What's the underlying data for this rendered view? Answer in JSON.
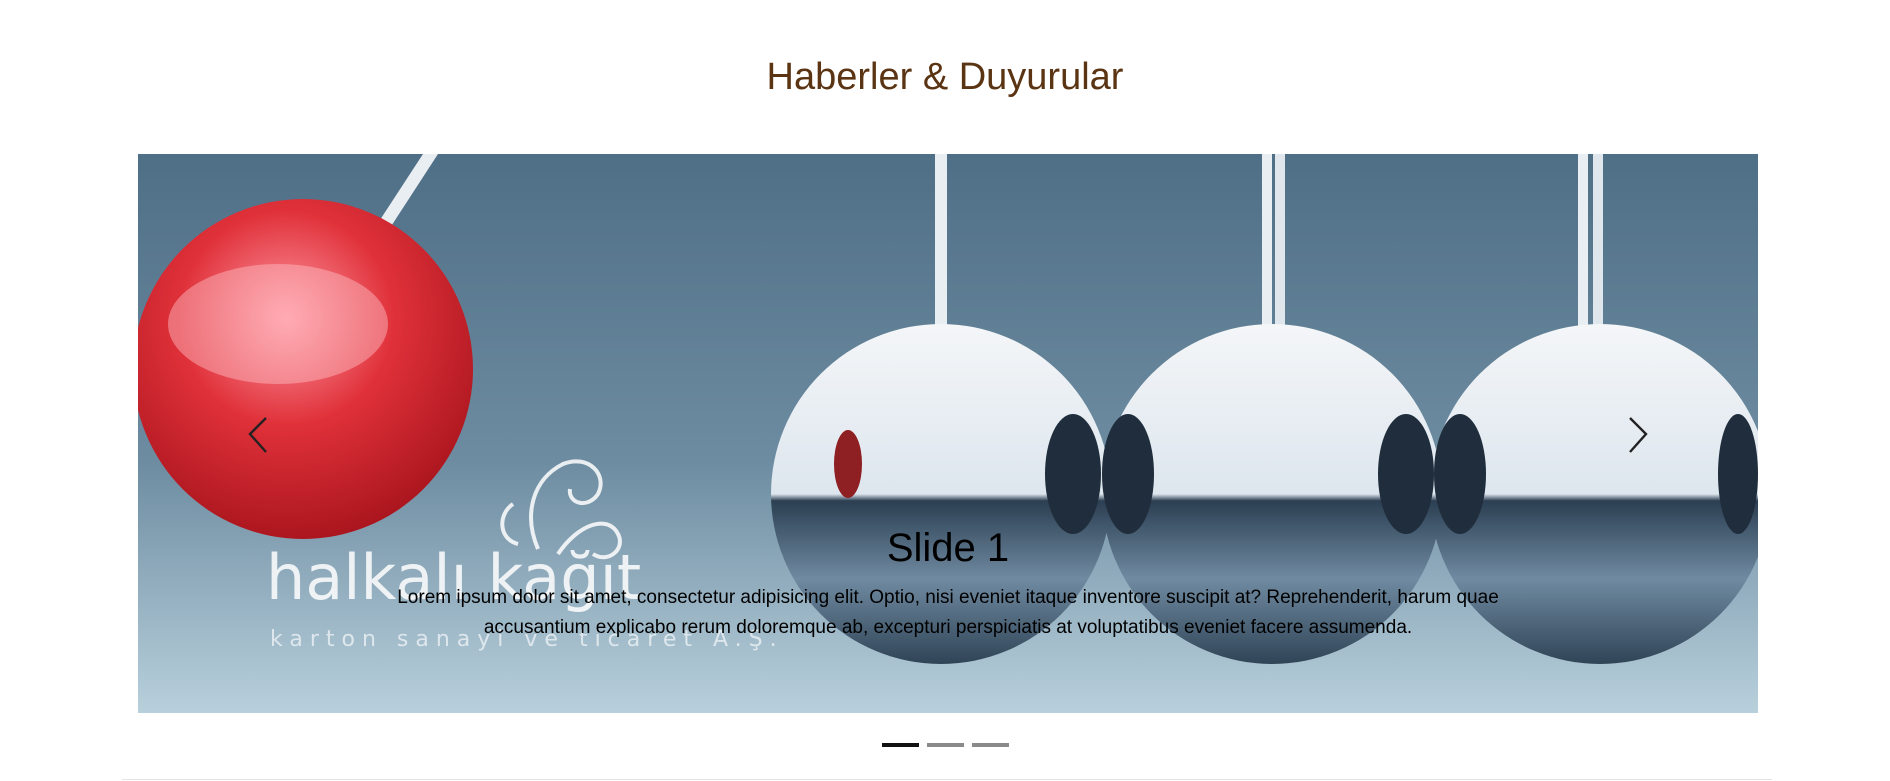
{
  "section": {
    "title": "Haberler & Duyurular"
  },
  "carousel": {
    "active_index": 0,
    "slide_count": 3,
    "slides": [
      {
        "title": "Slide 1",
        "text": "Lorem ipsum dolor sit amet, consectetur adipisicing elit. Optio, nisi eveniet itaque inventore suscipit at? Reprehenderit, harum quae accusantium explicabo rerum doloremque ab, excepturi perspiciatis at voluptatibus eveniet facere assumenda."
      }
    ],
    "image": {
      "logo_text": "halkalı kağıt",
      "logo_subtext": "karton sanayi ve ticaret A.Ş."
    }
  },
  "colors": {
    "title": "#5a3413",
    "indicator_active": "#111111",
    "indicator_inactive": "#8a8a8a",
    "backdrop_top": "#56758d",
    "backdrop_bottom": "#b4cdd9",
    "red_ball": "#d8232a"
  },
  "icons": {
    "prev": "chevron-left-icon",
    "next": "chevron-right-icon"
  }
}
